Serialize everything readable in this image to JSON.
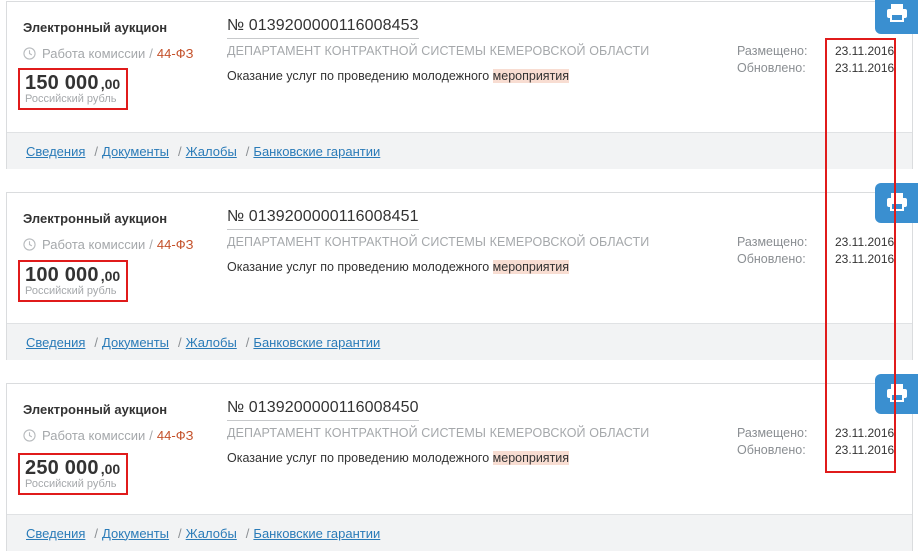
{
  "tenders": [
    {
      "type": "Электронный аукцион",
      "stage": "Работа комиссии",
      "law": "44-ФЗ",
      "price_main": "150 000",
      "price_dec": ",00",
      "currency": "Российский рубль",
      "number": "№ 0139200000116008453",
      "org": "ДЕПАРТАМЕНТ КОНТРАКТНОЙ СИСТЕМЫ КЕМЕРОВСКОЙ ОБЛАСТИ",
      "desc_text": "Оказание услуг по проведению молодежного ",
      "desc_highlight": "мероприятия",
      "placed_label": "Размещено:",
      "placed_date": "23.11.2016",
      "updated_label": "Обновлено:",
      "updated_date": "23.11.2016"
    },
    {
      "type": "Электронный аукцион",
      "stage": "Работа комиссии",
      "law": "44-ФЗ",
      "price_main": "100 000",
      "price_dec": ",00",
      "currency": "Российский рубль",
      "number": "№ 0139200000116008451",
      "org": "ДЕПАРТАМЕНТ КОНТРАКТНОЙ СИСТЕМЫ КЕМЕРОВСКОЙ ОБЛАСТИ",
      "desc_text": "Оказание услуг по проведению молодежного ",
      "desc_highlight": "мероприятия",
      "placed_label": "Размещено:",
      "placed_date": "23.11.2016",
      "updated_label": "Обновлено:",
      "updated_date": "23.11.2016"
    },
    {
      "type": "Электронный аукцион",
      "stage": "Работа комиссии",
      "law": "44-ФЗ",
      "price_main": "250 000",
      "price_dec": ",00",
      "currency": "Российский рубль",
      "number": "№ 0139200000116008450",
      "org": "ДЕПАРТАМЕНТ КОНТРАКТНОЙ СИСТЕМЫ КЕМЕРОВСКОЙ ОБЛАСТИ",
      "desc_text": "Оказание услуг по проведению молодежного ",
      "desc_highlight": "мероприятия",
      "placed_label": "Размещено:",
      "placed_date": "23.11.2016",
      "updated_label": "Обновлено:",
      "updated_date": "23.11.2016"
    }
  ],
  "footer_links": {
    "details": "Сведения",
    "documents": "Документы",
    "complaints": "Жалобы",
    "guarantees": "Банковские гарантии",
    "separator": "/"
  },
  "colors": {
    "link": "#2a7bb8",
    "law": "#c4512a",
    "highlight": "#f8ddd2",
    "annotation": "#e01b1b",
    "print_tab": "#3a8fd0"
  },
  "icons": {
    "stage": "clock-icon",
    "print": "printer-icon"
  }
}
